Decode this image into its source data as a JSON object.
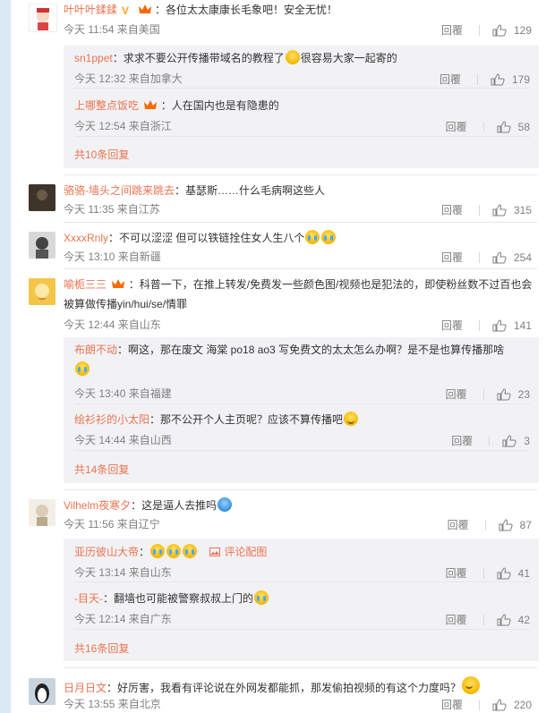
{
  "reply_label": "回覆",
  "comments": [
    {
      "user": "叶叶叶鍒鍒",
      "text": "：各位太太康康长毛象吧！安全无忧！",
      "time": "今天 11:54 来自美国",
      "likes": "129"
    },
    {
      "user": "sn1ppet",
      "text": "：求求不要公开传播带域名的教程了",
      "text2": "很容易大家一起寄的",
      "time": "今天 12:32 来自加拿大",
      "likes": "179"
    },
    {
      "user": "上哪整点饭吃",
      "text": "：人在国内也是有隐患的",
      "time": "今天 12:54 来自浙江",
      "likes": "58"
    },
    {
      "more": "共10条回复"
    },
    {
      "user": "骆骆-墙头之间跳来跳去",
      "text": "：基瑟斯……什么毛病啊这些人",
      "time": "今天 11:35 来自江苏",
      "likes": "315"
    },
    {
      "user": "XxxxRnly",
      "text": "：不可以涩涩 但可以铁链拴住女人生八个",
      "time": "今天 13:10 来自新疆",
      "likes": "254"
    },
    {
      "user": "喻栀三三",
      "text": "：科普一下，在推上转发/免费发一些颜色图/视频也是犯法的，即使粉丝数不过百也会",
      "text_line2": "被算做传播yin/hui/se/情罪",
      "time": "今天 12:44 来自山东",
      "likes": "141"
    },
    {
      "user": "布朗不动",
      "text": "：啊这，那在废文 海棠 po18 ao3 写免费文的太太怎么办啊？是不是也算传播那啥",
      "time": "今天 13:40 来自福建",
      "likes": "23"
    },
    {
      "user": "绘衫衫的小太阳",
      "text": "：那不公开个人主页呢？应该不算传播吧",
      "time": "今天 14:44 来自山西",
      "likes": "3"
    },
    {
      "more": "共14条回复"
    },
    {
      "user": "Vilhelm夜寒夕",
      "text": "：这是逼人去推吗",
      "time": "今天 11:56 来自辽宁",
      "likes": "87"
    },
    {
      "user": "亚历彼山大帝",
      "text": "：",
      "pic_label": "评论配图",
      "time": "今天 13:14 来自山东",
      "likes": "41"
    },
    {
      "user": "-目天-",
      "text": "：翻墙也可能被警察叔叔上门的",
      "time": "今天 12:14 来自广东",
      "likes": "42"
    },
    {
      "more": "共16条回复"
    },
    {
      "user": "日月日文",
      "text": "：好厉害，我看有评论说在外网发都能抓，那发偷拍视频的有这个力度吗？",
      "time": "今天 13:55 来自北京",
      "likes": "220"
    }
  ]
}
